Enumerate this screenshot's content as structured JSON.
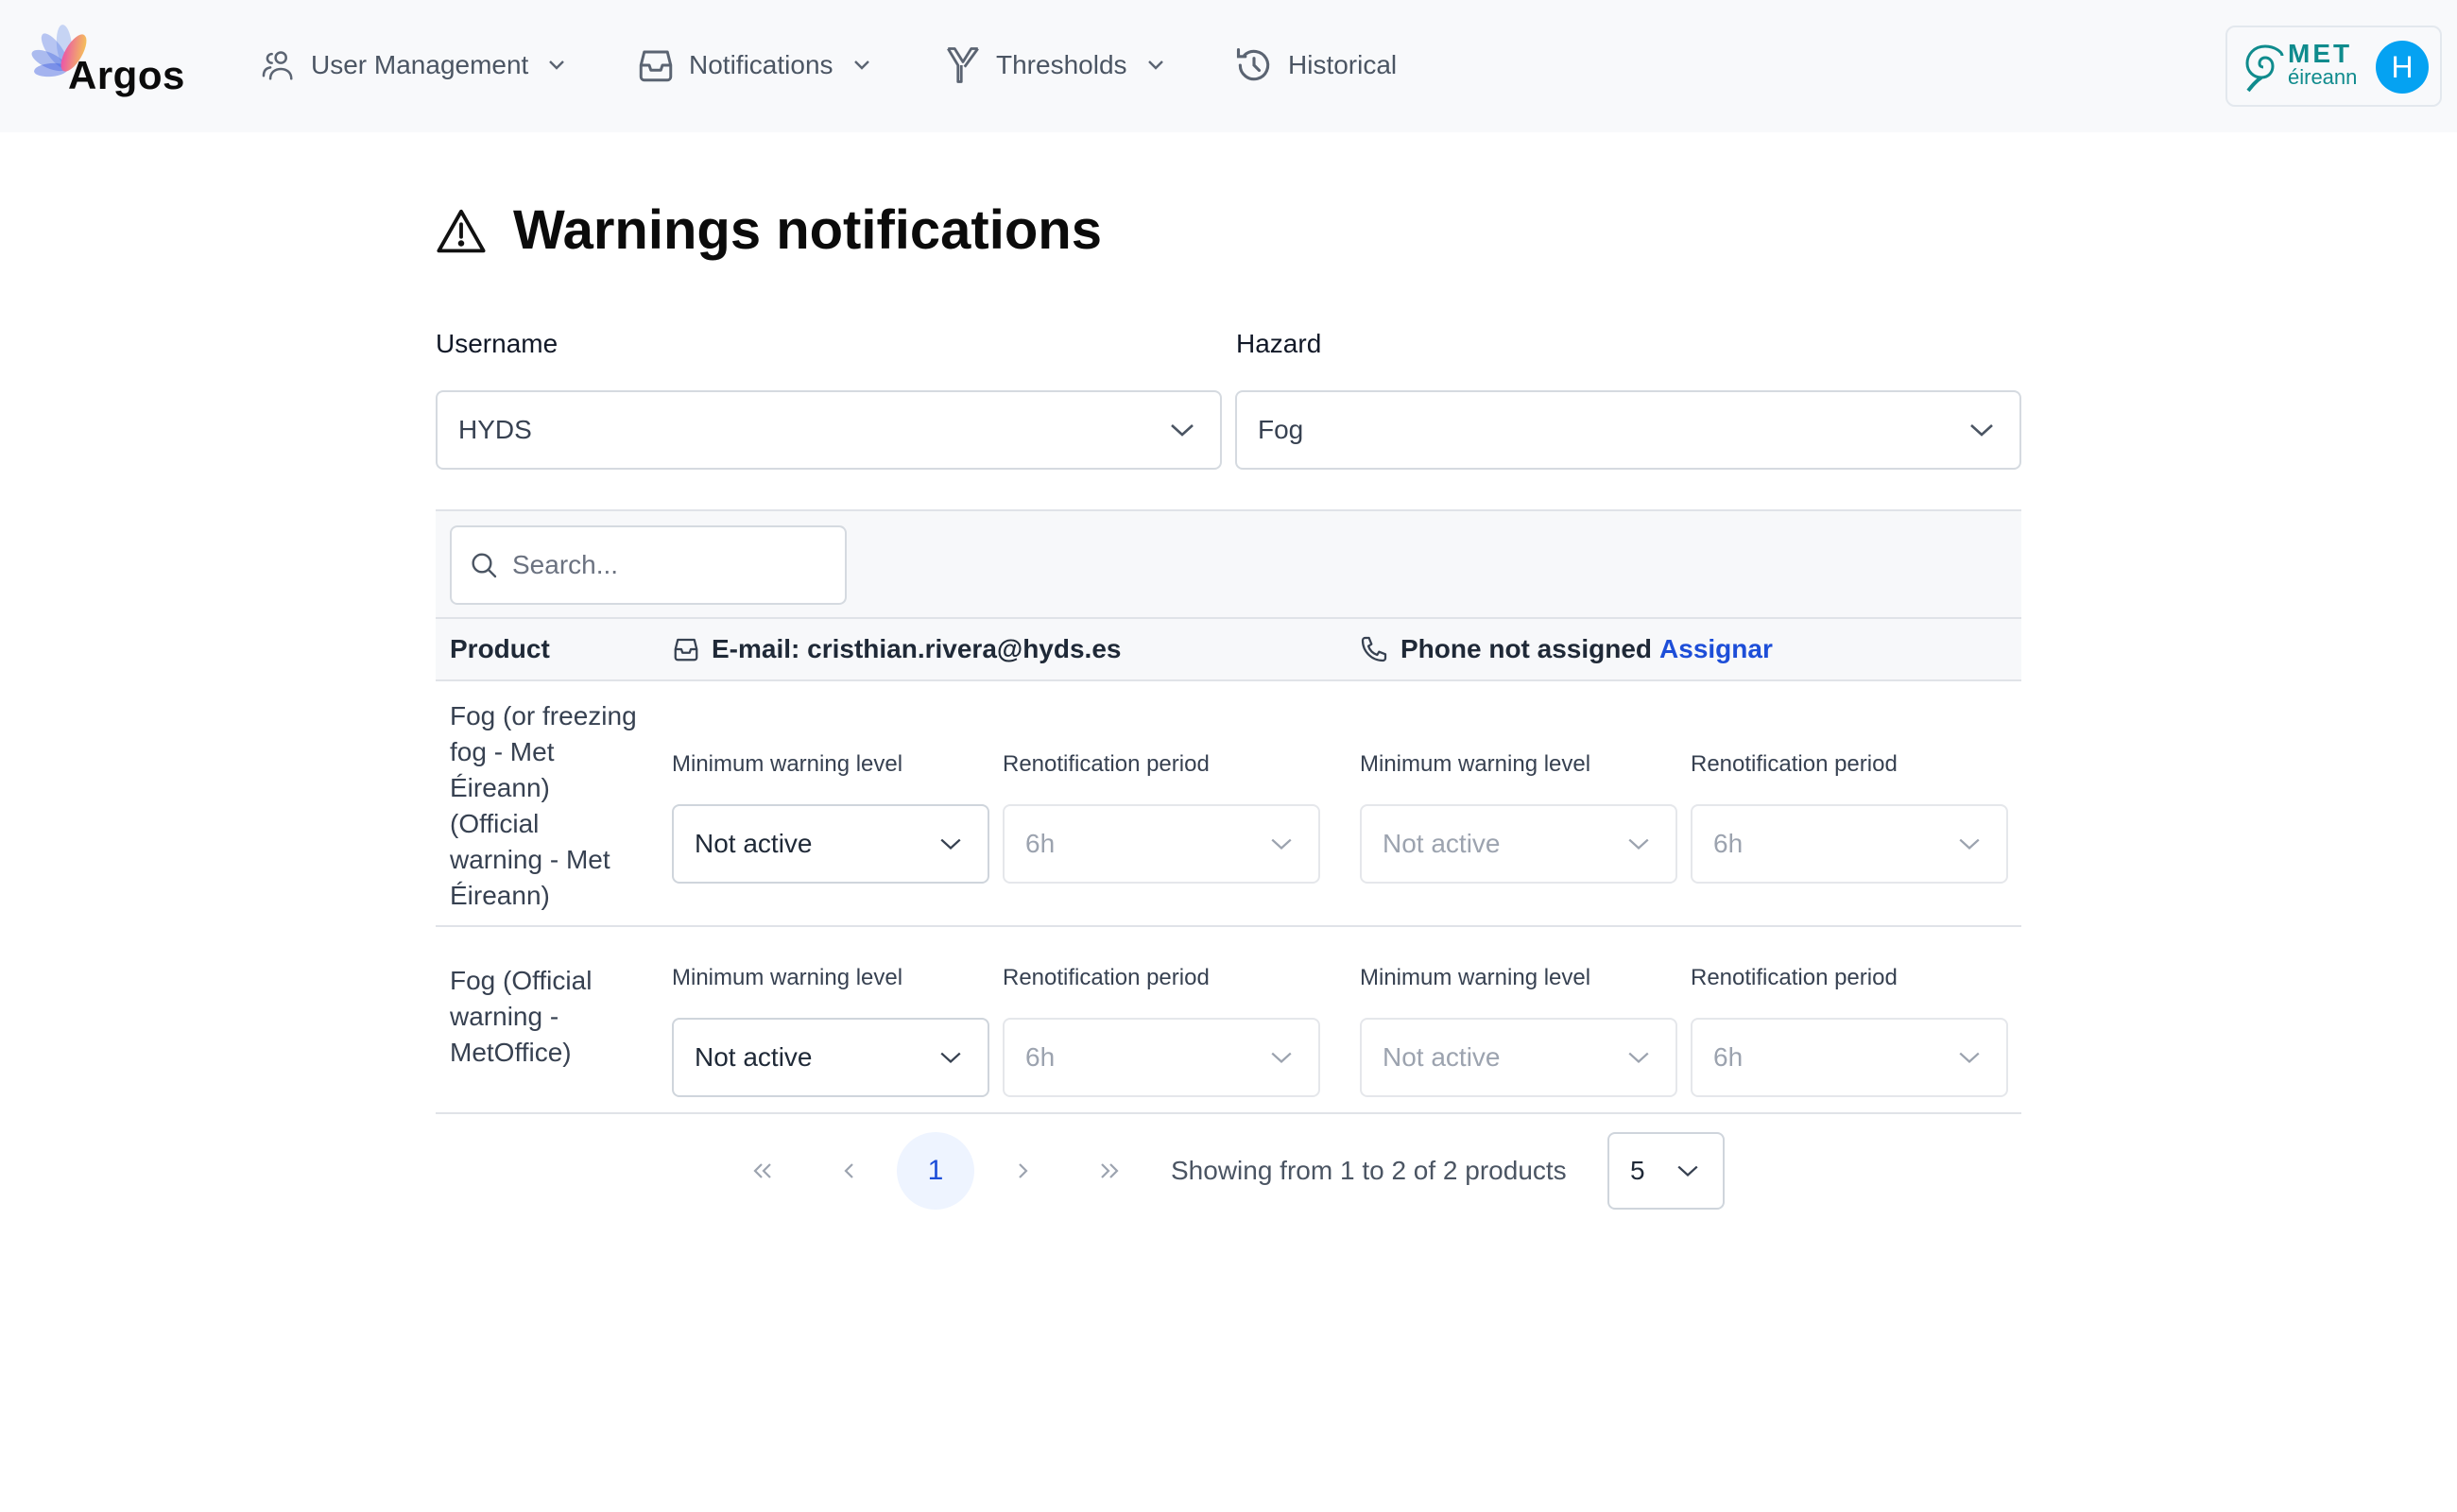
{
  "header": {
    "logo_text": "Argos",
    "nav": [
      {
        "label": "User Management",
        "icon": "users-icon",
        "has_dropdown": true
      },
      {
        "label": "Notifications",
        "icon": "inbox-icon",
        "has_dropdown": true
      },
      {
        "label": "Thresholds",
        "icon": "filter-icon",
        "has_dropdown": true
      },
      {
        "label": "Historical",
        "icon": "history-icon",
        "has_dropdown": false
      }
    ],
    "brand": {
      "line1": "MET",
      "line2": "éireann"
    },
    "avatar_initial": "H"
  },
  "page": {
    "title": "Warnings notifications",
    "title_icon": "warning-triangle-icon"
  },
  "filters": {
    "username": {
      "label": "Username",
      "value": "HYDS"
    },
    "hazard": {
      "label": "Hazard",
      "value": "Fog"
    }
  },
  "table": {
    "search_placeholder": "Search...",
    "search_value": "",
    "headers": {
      "product": "Product",
      "email": "E-mail: cristhian.rivera@hyds.es",
      "phone": "Phone not assigned",
      "phone_link": "Assignar"
    },
    "sub_labels": {
      "min_level": "Minimum warning level",
      "renotify": "Renotification period"
    },
    "rows": [
      {
        "product": "Fog (or freezing fog - Met Éireann) (Official warning - Met Éireann)",
        "email_min_level": "Not active",
        "email_renotify": "6h",
        "phone_min_level": "Not active",
        "phone_renotify": "6h"
      },
      {
        "product": "Fog (Official warning - MetOffice)",
        "email_min_level": "Not active",
        "email_renotify": "6h",
        "phone_min_level": "Not active",
        "phone_renotify": "6h"
      }
    ]
  },
  "pagination": {
    "first": "«",
    "prev": "‹",
    "current_page": "1",
    "next": "›",
    "last": "»",
    "info": "Showing from 1 to 2 of 2 products",
    "page_size": "5"
  },
  "colors": {
    "accent": "#1d4ed8",
    "avatar": "#05a2f2",
    "brand_teal": "#0f8b8d",
    "header_bg": "#f8f9fb"
  }
}
